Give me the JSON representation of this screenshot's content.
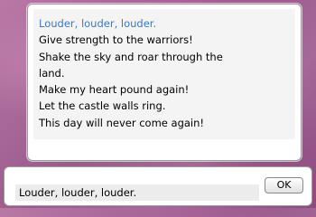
{
  "message": {
    "lines": [
      "Louder, louder, louder.",
      "Give strength to the warriors!",
      "Shake the sky and roar through the",
      "land.",
      "Make my heart pound again!",
      "Let the castle walls ring.",
      "This day will never come again!"
    ]
  },
  "answer_input": {
    "value": "Louder, louder, louder."
  },
  "ok_button": {
    "label": "OK"
  }
}
